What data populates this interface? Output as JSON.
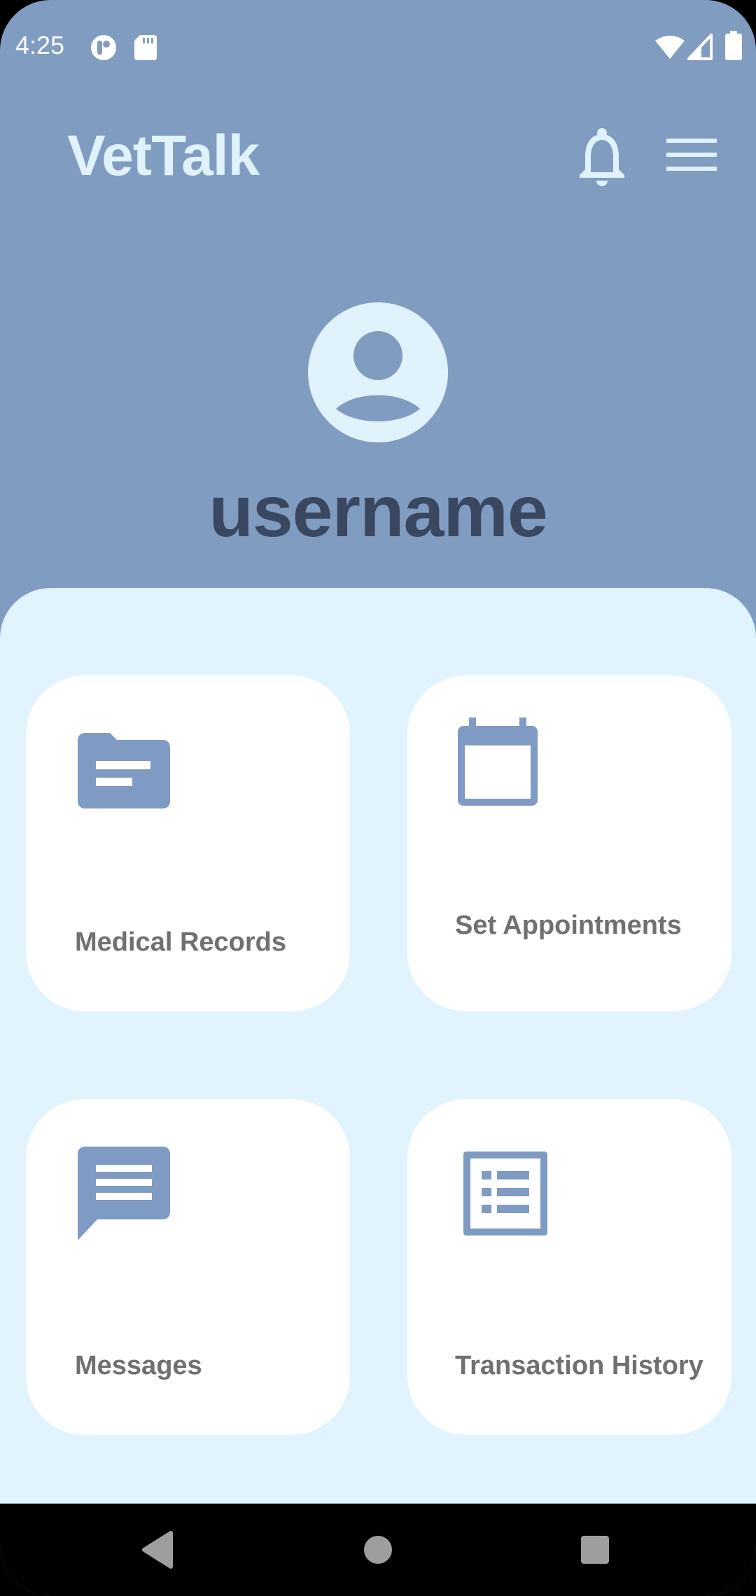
{
  "status_bar": {
    "time": "4:25",
    "icons_left": [
      "app-notification-icon",
      "sd-card-icon"
    ],
    "icons_right": [
      "wifi-icon",
      "cellular-signal-icon",
      "battery-icon"
    ]
  },
  "header": {
    "title": "VetTalk",
    "notification_icon": "bell-icon",
    "menu_icon": "hamburger-menu-icon"
  },
  "profile": {
    "avatar_icon": "account-circle-icon",
    "username": "username"
  },
  "cards": [
    {
      "label": "Medical Records",
      "icon": "folder-icon"
    },
    {
      "label": "Set Appointments",
      "icon": "calendar-icon"
    },
    {
      "label": "Messages",
      "icon": "message-icon"
    },
    {
      "label": "Transaction History",
      "icon": "list-icon"
    }
  ],
  "nav_bar": {
    "back_icon": "back-triangle-icon",
    "home_icon": "home-circle-icon",
    "recents_icon": "recents-square-icon"
  },
  "colors": {
    "header_bg": "#809CC1",
    "panel_bg": "#E1F3FD",
    "title_color": "#E0F2FC",
    "username_color": "#3A4760",
    "icon_color": "#7F9AC3",
    "card_label_color": "#707070"
  }
}
